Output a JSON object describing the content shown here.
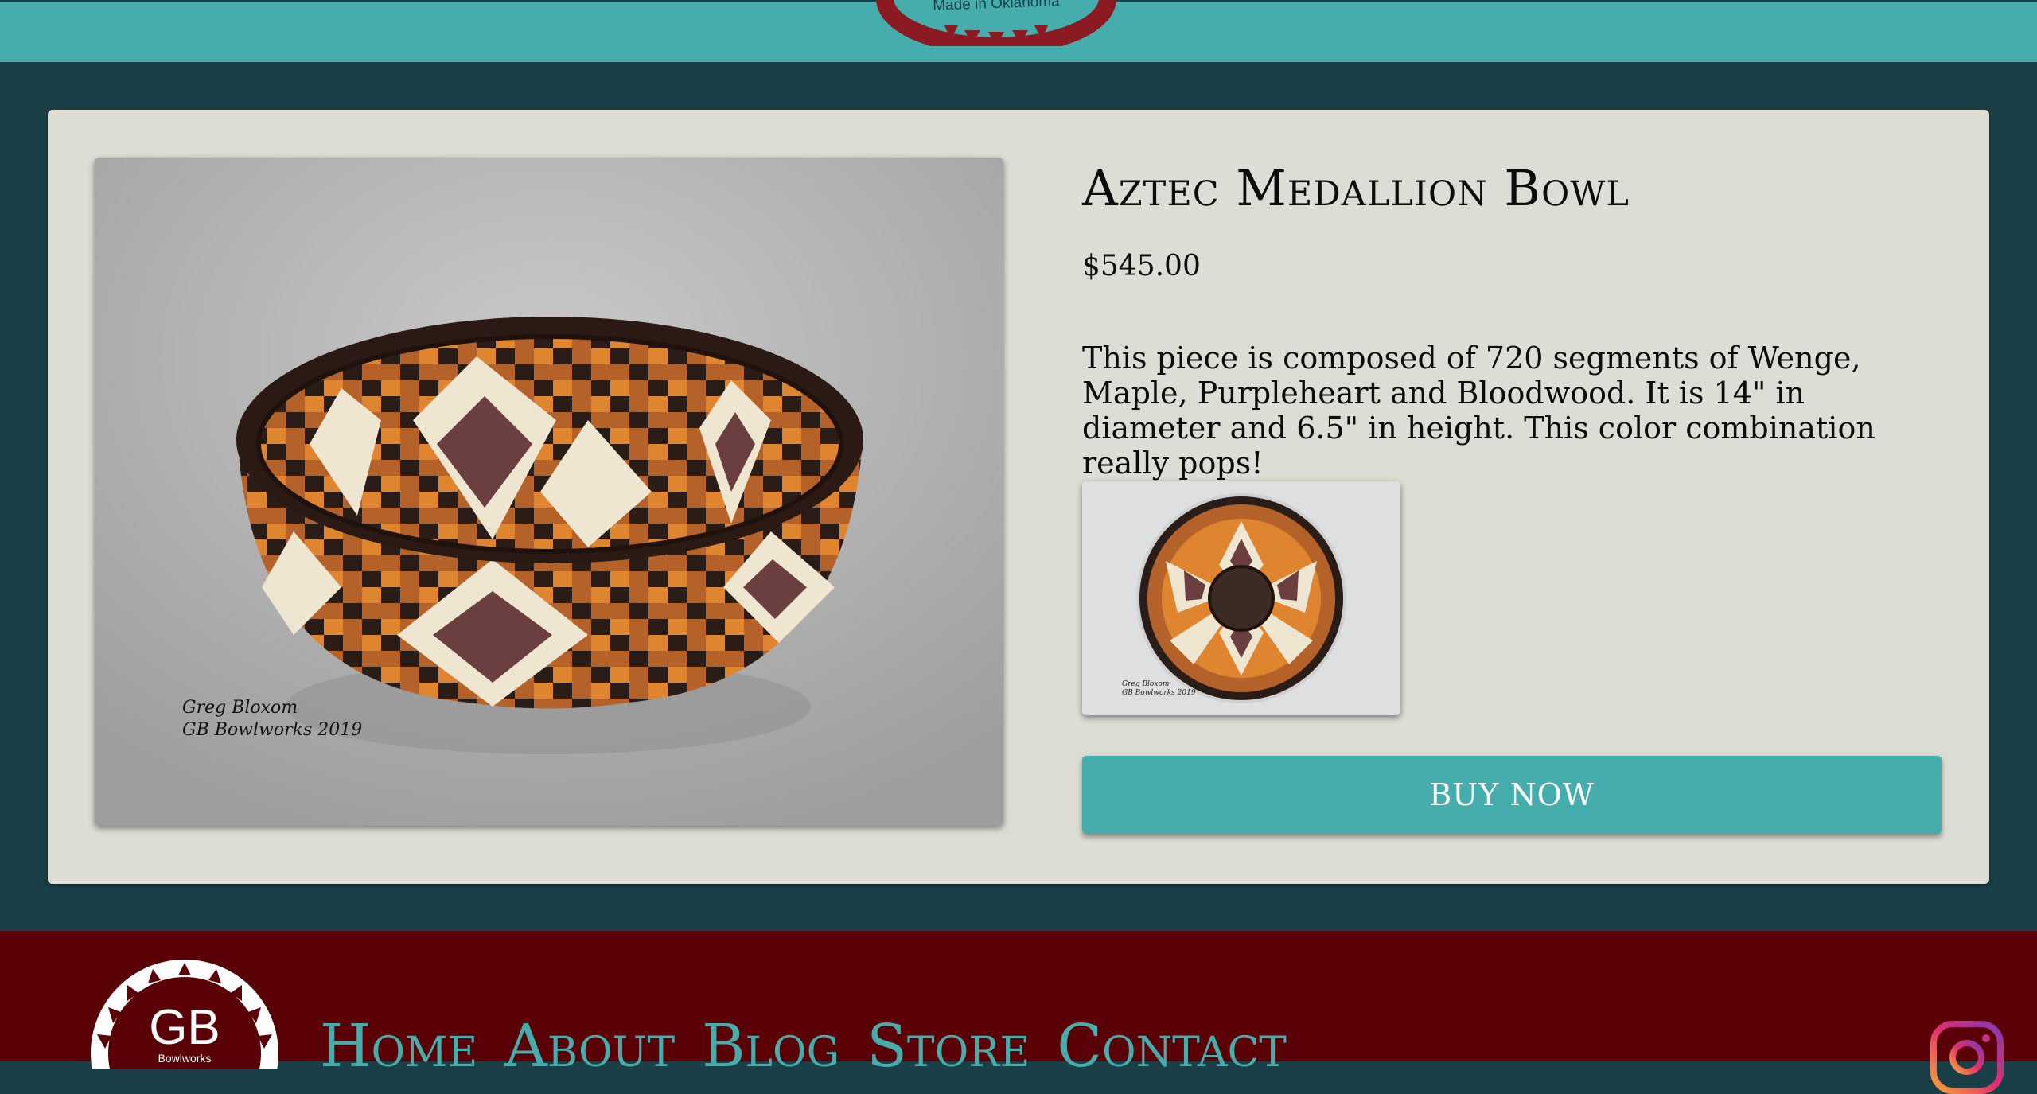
{
  "header": {
    "logo_text": "Made in Oklahoma"
  },
  "product": {
    "title": "Aztec Medallion Bowl",
    "price": "$545.00",
    "description": "This piece is composed of 720 segments of Wenge, Maple, Purpleheart and Bloodwood. It is 14\" in diameter and 6.5\" in height. This color combination really pops!",
    "image_signature_line1": "Greg Bloxom",
    "image_signature_line2": "GB Bowlworks 2019",
    "buy_label": "BUY NOW"
  },
  "footer": {
    "logo_text": "GB",
    "logo_sub": "Bowlworks",
    "nav": [
      "Home",
      "About",
      "Blog",
      "Store",
      "Contact"
    ]
  },
  "colors": {
    "teal": "#45aeac",
    "dark_teal": "#1b3f47",
    "card": "#dcddd5",
    "maroon": "#5a0007"
  }
}
